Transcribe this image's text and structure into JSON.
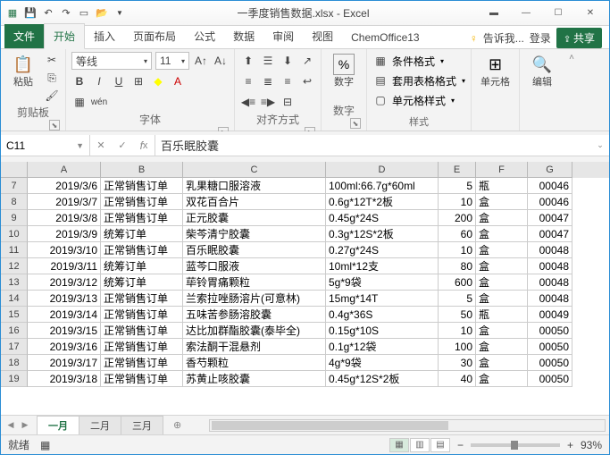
{
  "title": "一季度销售数据.xlsx - Excel",
  "tabs": {
    "file": "文件",
    "home": "开始",
    "insert": "插入",
    "layout": "页面布局",
    "formula": "公式",
    "data": "数据",
    "review": "审阅",
    "view": "视图",
    "chemoffice": "ChemOffice13",
    "tell": "告诉我...",
    "login": "登录",
    "share": "共享"
  },
  "ribbon": {
    "clipboard": {
      "paste": "粘贴",
      "label": "剪贴板"
    },
    "font": {
      "name": "等线",
      "size": "11",
      "label": "字体"
    },
    "align": {
      "label": "对齐方式"
    },
    "number": {
      "btn": "数字",
      "label": "数字"
    },
    "styles": {
      "cond": "条件格式",
      "table": "套用表格格式",
      "cell": "单元格样式",
      "label": "样式"
    },
    "cells": {
      "btn": "单元格"
    },
    "editing": {
      "btn": "编辑"
    }
  },
  "nameBox": "C11",
  "formula": "百乐眠胶囊",
  "cols": [
    "A",
    "B",
    "C",
    "D",
    "E",
    "F",
    "G"
  ],
  "rows": [
    {
      "n": 7,
      "c": [
        "2019/3/6",
        "正常销售订单",
        "乳果糖口服溶液",
        "100ml:66.7g*60ml",
        "5",
        "瓶",
        "00046"
      ]
    },
    {
      "n": 8,
      "c": [
        "2019/3/7",
        "正常销售订单",
        "双花百合片",
        "0.6g*12T*2板",
        "10",
        "盒",
        "00046"
      ]
    },
    {
      "n": 9,
      "c": [
        "2019/3/8",
        "正常销售订单",
        "正元胶囊",
        "0.45g*24S",
        "200",
        "盒",
        "00047"
      ]
    },
    {
      "n": 10,
      "c": [
        "2019/3/9",
        "统筹订单",
        "柴芩清宁胶囊",
        "0.3g*12S*2板",
        "60",
        "盒",
        "00047"
      ]
    },
    {
      "n": 11,
      "c": [
        "2019/3/10",
        "正常销售订单",
        "百乐眠胶囊",
        "0.27g*24S",
        "10",
        "盒",
        "00048"
      ]
    },
    {
      "n": 12,
      "c": [
        "2019/3/11",
        "统筹订单",
        "蓝芩口服液",
        "10ml*12支",
        "80",
        "盒",
        "00048"
      ]
    },
    {
      "n": 13,
      "c": [
        "2019/3/12",
        "统筹订单",
        "荜铃胃痛颗粒",
        "5g*9袋",
        "600",
        "盒",
        "00048"
      ]
    },
    {
      "n": 14,
      "c": [
        "2019/3/13",
        "正常销售订单",
        "兰索拉唑肠溶片(可意林)",
        "15mg*14T",
        "5",
        "盒",
        "00048"
      ]
    },
    {
      "n": 15,
      "c": [
        "2019/3/14",
        "正常销售订单",
        "五味苦参肠溶胶囊",
        "0.4g*36S",
        "50",
        "瓶",
        "00049"
      ]
    },
    {
      "n": 16,
      "c": [
        "2019/3/15",
        "正常销售订单",
        "达比加群酯胶囊(泰毕全)",
        "0.15g*10S",
        "10",
        "盒",
        "00050"
      ]
    },
    {
      "n": 17,
      "c": [
        "2019/3/16",
        "正常销售订单",
        "索法酮干混悬剂",
        "0.1g*12袋",
        "100",
        "盒",
        "00050"
      ]
    },
    {
      "n": 18,
      "c": [
        "2019/3/17",
        "正常销售订单",
        "香芍颗粒",
        "4g*9袋",
        "30",
        "盒",
        "00050"
      ]
    },
    {
      "n": 19,
      "c": [
        "2019/3/18",
        "正常销售订单",
        "苏黄止咳胶囊",
        "0.45g*12S*2板",
        "40",
        "盒",
        "00050"
      ]
    }
  ],
  "sheets": [
    "一月",
    "二月",
    "三月"
  ],
  "status": {
    "ready": "就绪",
    "zoom": "93%"
  }
}
